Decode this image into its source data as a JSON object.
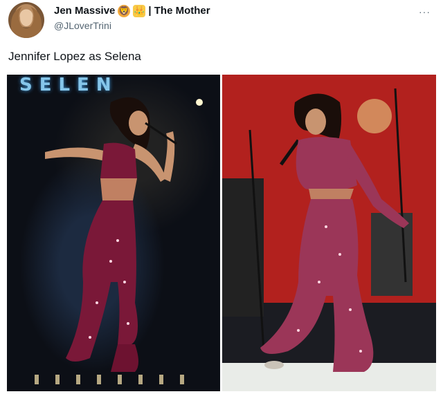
{
  "post": {
    "display_name": "Jen Massive",
    "separator_and_badge": "| The Mother",
    "handle": "@JLoverTrini",
    "text": "Jennifer Lopez as Selena",
    "more_label": "···"
  },
  "icons": {
    "avatar": "avatar",
    "emoji_1": "lion-emoji-icon",
    "emoji_2": "crown-emoji-icon",
    "more": "more-options-icon"
  },
  "photos": {
    "left_sign_text": "SELEN"
  },
  "colors": {
    "text_primary": "#0f1419",
    "text_secondary": "#536471",
    "outfit_left": "#7a1838",
    "outfit_right": "#9b3658",
    "stage_red": "#b2211e"
  }
}
